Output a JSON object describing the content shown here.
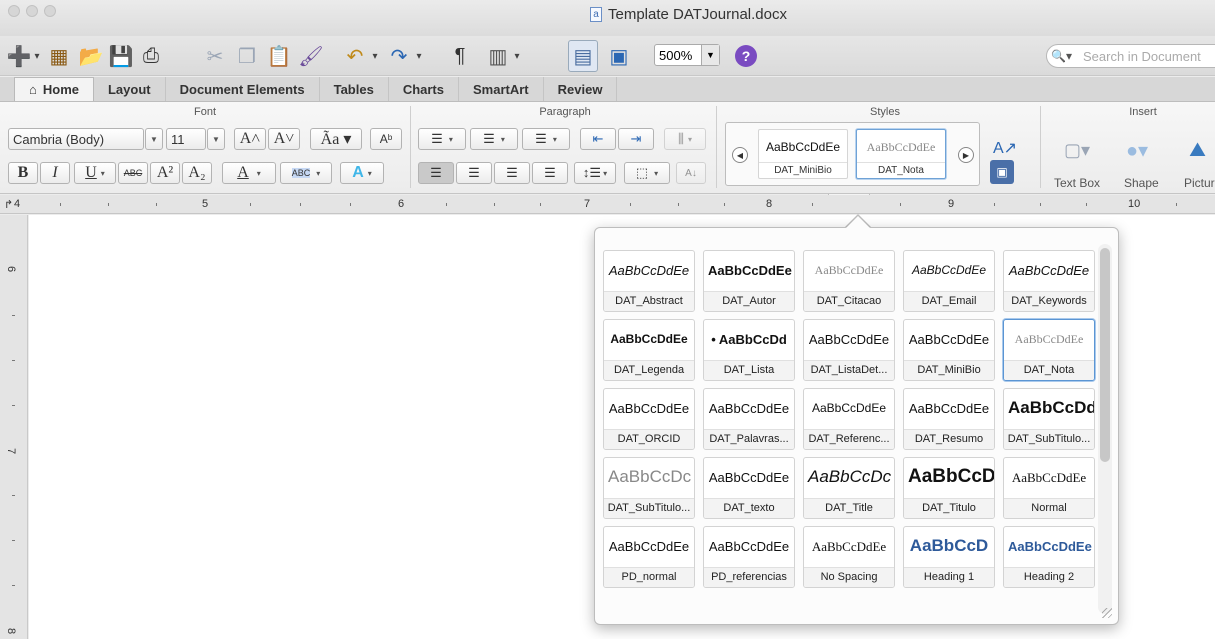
{
  "window": {
    "title": "Template DATJournal.docx"
  },
  "toolbar": {
    "zoom_value": "500%",
    "search_placeholder": "Search in Document",
    "pilcrow": "¶"
  },
  "tabs": [
    {
      "label": "Home",
      "active": true
    },
    {
      "label": "Layout"
    },
    {
      "label": "Document Elements"
    },
    {
      "label": "Tables"
    },
    {
      "label": "Charts"
    },
    {
      "label": "SmartArt"
    },
    {
      "label": "Review"
    }
  ],
  "ribbon": {
    "font_group": "Font",
    "paragraph_group": "Paragraph",
    "styles_group": "Styles",
    "insert_group": "Insert",
    "font_name": "Cambria (Body)",
    "font_size": "11",
    "gallery": [
      {
        "sample": "AaBbCcDdEe",
        "name": "DAT_MiniBio"
      },
      {
        "sample": "AaBbCcDdEe",
        "name": "DAT_Nota"
      }
    ],
    "insert_items": [
      "Text Box",
      "Shape",
      "Picture"
    ]
  },
  "ruler": {
    "marks": [
      "4",
      "5",
      "6",
      "7",
      "8",
      "9",
      "10"
    ]
  },
  "vruler": {
    "marks": [
      "6",
      "7",
      "8"
    ]
  },
  "styles_popover": {
    "items": [
      {
        "sample": "AaBbCcDdEe",
        "name": "DAT_Abstract"
      },
      {
        "sample": "AaBbCcDdEe",
        "name": "DAT_Autor"
      },
      {
        "sample": "AaBbCcDdEe",
        "name": "DAT_Citacao"
      },
      {
        "sample": "AaBbCcDdEe",
        "name": "DAT_Email"
      },
      {
        "sample": "AaBbCcDdEe",
        "name": "DAT_Keywords"
      },
      {
        "sample": "AaBbCcDdEe",
        "name": "DAT_Legenda"
      },
      {
        "sample": "• AaBbCcDd",
        "name": "DAT_Lista"
      },
      {
        "sample": "AaBbCcDdEe",
        "name": "DAT_ListaDet..."
      },
      {
        "sample": "AaBbCcDdEe",
        "name": "DAT_MiniBio"
      },
      {
        "sample": "AaBbCcDdEe",
        "name": "DAT_Nota"
      },
      {
        "sample": "AaBbCcDdEe",
        "name": "DAT_ORCID"
      },
      {
        "sample": "AaBbCcDdEe",
        "name": "DAT_Palavras..."
      },
      {
        "sample": "AaBbCcDdEe",
        "name": "DAT_Referenc..."
      },
      {
        "sample": "AaBbCcDdEe",
        "name": "DAT_Resumo"
      },
      {
        "sample": "AaBbCcDd",
        "name": "DAT_SubTitulo..."
      },
      {
        "sample": "AaBbCcDc",
        "name": "DAT_SubTitulo..."
      },
      {
        "sample": "AaBbCcDdEe",
        "name": "DAT_texto"
      },
      {
        "sample": "AaBbCcDc",
        "name": "DAT_Title"
      },
      {
        "sample": "AaBbCcD",
        "name": "DAT_Titulo"
      },
      {
        "sample": "AaBbCcDdEe",
        "name": "Normal"
      },
      {
        "sample": "AaBbCcDdEe",
        "name": "PD_normal"
      },
      {
        "sample": "AaBbCcDdEe",
        "name": "PD_referencias"
      },
      {
        "sample": "AaBbCcDdEe",
        "name": "No Spacing"
      },
      {
        "sample": "AaBbCcD",
        "name": "Heading 1"
      },
      {
        "sample": "AaBbCcDdEe",
        "name": "Heading 2"
      }
    ]
  }
}
